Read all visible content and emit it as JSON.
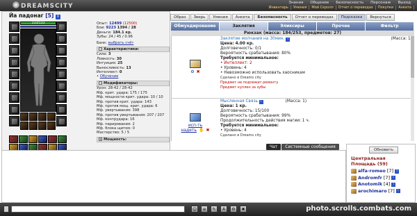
{
  "header": {
    "logo_text": "DREAMSCITY",
    "nav": [
      "Знания",
      "Общение",
      "Безопасность",
      "Персонаж",
      "Выход"
    ],
    "subnav": [
      "Инвентарь",
      "Умения",
      "Мой Скролл",
      "Отчет о переводах",
      "Покупки",
      "Анкета"
    ]
  },
  "character": {
    "name": "Йа падонаг",
    "level": "[5]",
    "hp_text": "133/133",
    "hp_fraction": 1.0,
    "stats": [
      {
        "label": "Опыт:",
        "value": "12499",
        "extra": "(12500)"
      },
      {
        "label": "Бои:",
        "value": "9223",
        "extra": "1394 / 28"
      },
      {
        "label": "Деньги:",
        "value": "184.1 кр."
      },
      {
        "label": "Зубы:",
        "value": "24 / 45 / 0.96"
      },
      {
        "label": "Банк:",
        "value": "выбрать счёт"
      }
    ],
    "char_header": "Характеристики:",
    "characteristics": [
      {
        "label": "Сила:",
        "value": "3"
      },
      {
        "label": "Ловкость:",
        "value": "30"
      },
      {
        "label": "Интуиция:",
        "value": "25"
      },
      {
        "label": "Выносливость:",
        "value": "13"
      },
      {
        "label": "Интеллект:",
        "value": "0"
      }
    ],
    "training_link": "Обучение",
    "mod_header": "Модификаторы:",
    "modifiers": [
      {
        "label": "Урон:",
        "value": "28-42 / 28-42"
      },
      {
        "label": "Мф. крит. удара:",
        "value": "175 / 175"
      },
      {
        "label": "Мф. мощности крит. удара:",
        "value": "10 / 10"
      },
      {
        "label": "Мф. против крит. удара:",
        "value": "143"
      },
      {
        "label": "Мф. против мощ. крит. удара:",
        "value": "6"
      },
      {
        "label": "Мф. увертывания:",
        "value": "398"
      },
      {
        "label": "Мф. против увертывания:",
        "value": "207 / 207"
      },
      {
        "label": "Мф. контрудара:",
        "value": "16"
      },
      {
        "label": "Мф. парирования:",
        "value": "2"
      },
      {
        "label": "Мф. блока щитом:",
        "value": "0"
      },
      {
        "label": "Мастерство:",
        "value": "5 / 5"
      }
    ],
    "power_header": "Мощность:"
  },
  "tabs_top": [
    "Образ",
    "Зверь",
    "Умения",
    "Анкета",
    "Безопасность",
    "Отчет о переводах",
    "Подсказка",
    "Вернуться"
  ],
  "tabs_main": [
    "Обмундирование",
    "Заклятия",
    "Эликсиры",
    "Прочее",
    "Фильтр"
  ],
  "active_main_tab": "Заклятия",
  "bag_header": "Рюкзак (масса: 184/253, предметов: 27)",
  "items": [
    {
      "name": "Заклятие молчания на 30мин.",
      "mass": "(Масса: 1)",
      "price": "Цена: 4.00 кр.",
      "lines": [
        "Долговечность: 0/1",
        "Вероятность срабатывания: 80%"
      ],
      "req_header": "Требуется минимальное:",
      "reqs": [
        {
          "text": "• Интеллект: 2",
          "red": true
        },
        {
          "text": "• Уровень: 4",
          "red": false
        },
        {
          "text": "• Невозможно использовать хаосникам",
          "red": false
        }
      ],
      "made": "Сделано в Dreams city",
      "warns": [
        "Предмет не подлежит ремонту",
        "Предмет куплен за зубы"
      ]
    },
    {
      "name": "Мысленная Связь",
      "mass": "(Масса: 1)",
      "price": "Цена: 1 кр.",
      "lines": [
        "Долговечность: 15/100",
        "Вероятность срабатывания: 99%",
        "Продолжительность действия магии: 1 ч."
      ],
      "req_header": "Требуется минимальное:",
      "reqs": [
        {
          "text": "• Уровень: 4",
          "red": false
        }
      ],
      "made": "Сделано в Dreams city",
      "warns": [],
      "actions": [
        "исп-ть",
        "надеть"
      ]
    }
  ],
  "chat": {
    "tabs": [
      "Чат",
      "Системные сообщения"
    ]
  },
  "sidebar": {
    "refresh_label": "Обновить",
    "location_line1": "Центральная",
    "location_line2": "Площадь (59)",
    "players": [
      {
        "nick": "alfa-romeo",
        "level": "[7]"
      },
      {
        "nick": "Andromfr",
        "level": "[7]"
      },
      {
        "nick": "Anotomik",
        "level": "[4]"
      },
      {
        "nick": "arochimaro",
        "level": "[7]"
      }
    ]
  },
  "bottom": {
    "watermark": "photo.scrolls.combats.com"
  },
  "colors": {
    "accent": "#56709f",
    "link": "#1c2c9c",
    "warning": "#c00000"
  }
}
